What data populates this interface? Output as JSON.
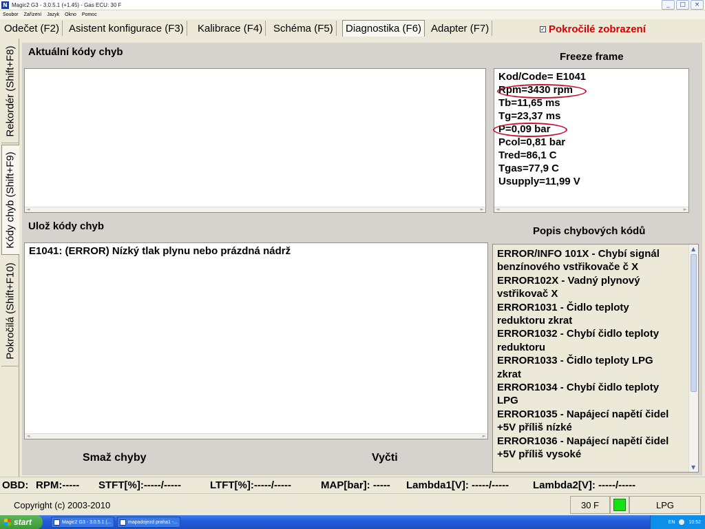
{
  "window": {
    "title": "Magic2 G3 - 3.0.5.1 (+1.45) - Gas ECU: 30 F",
    "icon": "app-icon",
    "controls": [
      "minimize-icon",
      "maximize-icon",
      "close-icon"
    ]
  },
  "menu": [
    "Soubor",
    "Zařízení",
    "Jazyk",
    "Okno",
    "Pomoc"
  ],
  "tabs": [
    {
      "label": "Odečet (F2)"
    },
    {
      "label": "Asistent konfigurace (F3)"
    },
    {
      "label": "Kalibrace (F4)"
    },
    {
      "label": "Schéma (F5)"
    },
    {
      "label": "Diagnostika (F6)",
      "active": true
    },
    {
      "label": "Adapter (F7)"
    }
  ],
  "advanced_view": {
    "label": "Pokročilé zobrazení",
    "checked": true,
    "check_mark": "✓",
    "color": "#d40000"
  },
  "side_tabs": [
    {
      "label": "Rekordér (Shift+F8)"
    },
    {
      "label": "Kódy chyb (Shift+F9)",
      "active": true
    },
    {
      "label": "Pokročilá (Shift+F10)"
    }
  ],
  "current_codes": {
    "title": "Aktuální kódy chyb",
    "items": []
  },
  "freeze_frame": {
    "title": "Freeze frame",
    "lines": [
      "Kod/Code= E1041",
      "Rpm=3430 rpm",
      "Tb=11,65 ms",
      "Tg=23,37 ms",
      "P=0,09 bar",
      "Pcol=0,81 bar",
      "Tred=86,1 C",
      "Tgas=77,9 C",
      "Usupply=11,99 V"
    ],
    "highlight_color": "#c8102e"
  },
  "saved_codes": {
    "title": "Ulož kódy chyb",
    "items": [
      "E1041: (ERROR) Nízký tlak plynu nebo prázdná nádrž"
    ]
  },
  "error_descriptions": {
    "title": "Popis chybových kódů",
    "lines": [
      "ERROR/INFO 101X - Chybí signál",
      "benzínového vstřikovače č X",
      "ERROR102X - Vadný plynový",
      "vstřikovač X",
      "ERROR1031 - Čidlo teploty",
      "reduktoru zkrat",
      "ERROR1032 - Chybí čidlo teploty",
      "reduktoru",
      "ERROR1033 - Čidlo teploty LPG",
      "zkrat",
      "ERROR1034 - Chybí čidlo teploty",
      "LPG",
      "ERROR1035 - Napájecí napětí čidel",
      "+5V příliš nízké",
      "ERROR1036 - Napájecí napětí čidel",
      "+5V příliš vysoké"
    ]
  },
  "buttons": {
    "clear": "Smaž chyby",
    "read": "Vyčti"
  },
  "obd": {
    "label": "OBD:",
    "rpm": "RPM:-----",
    "stft": "STFT[%]:-----/-----",
    "ltft": "LTFT[%]:-----/-----",
    "map": "MAP[bar]: -----",
    "lambda1": "Lambda1[V]: -----/-----",
    "lambda2": "Lambda2[V]: -----/-----"
  },
  "status": {
    "copyright": "Copyright (c) 2003-2010",
    "ecu": "30 F",
    "fuel": "LPG",
    "led_color": "#16e016"
  },
  "taskbar": {
    "start": "start",
    "items": [
      "Magic2 G3 - 3.0.5.1 (...",
      "mapadojezd praha1 -..."
    ],
    "language": "EN",
    "clock": "10:52"
  }
}
